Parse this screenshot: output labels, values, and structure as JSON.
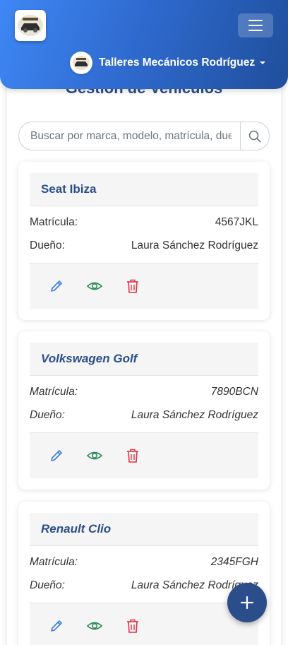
{
  "header": {
    "logo_alt": "garage-logo",
    "menu_icon": "hamburger-icon",
    "user_name": "Talleres Mecánicos Rodríguez"
  },
  "page": {
    "title": "Gestión de Vehículos"
  },
  "search": {
    "placeholder": "Buscar por marca, modelo, matrícula, dueño..."
  },
  "labels": {
    "plate": "Matrícula:",
    "owner": "Dueño:"
  },
  "vehicles": [
    {
      "name": "Seat Ibiza",
      "plate": "4567JKL",
      "owner": "Laura Sánchez Rodríguez"
    },
    {
      "name": "Volkswagen Golf",
      "plate": "7890BCN",
      "owner": "Laura Sánchez Rodríguez"
    },
    {
      "name": "Renault Clio",
      "plate": "2345FGH",
      "owner": "Laura Sánchez Rodríguez"
    }
  ],
  "colors": {
    "primary": "#2b4e8b",
    "edit": "#3b7ddd",
    "view": "#2e8b57",
    "delete": "#dc3545"
  }
}
